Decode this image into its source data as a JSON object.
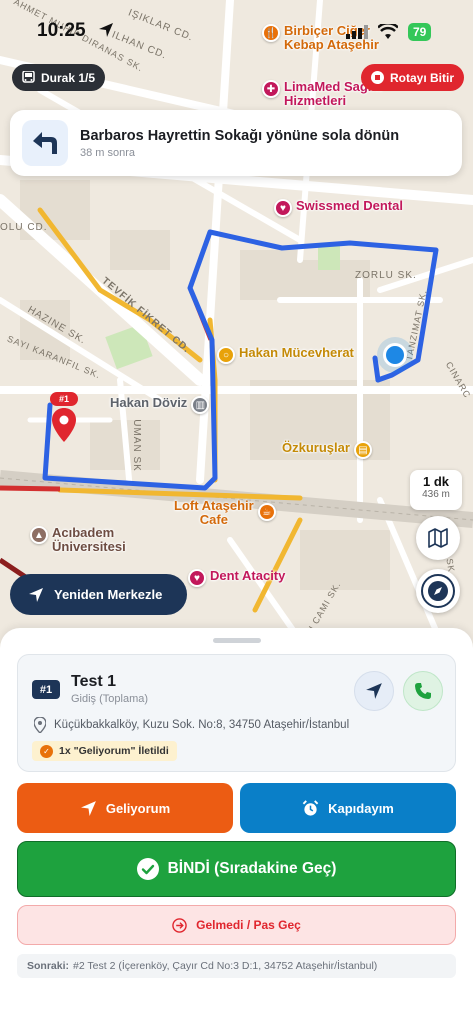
{
  "status_bar": {
    "time": "10:25",
    "battery": "79"
  },
  "map": {
    "streets": [
      "IŞIKLAR CD.",
      "AHMET MUHIP DIRANAS SK.",
      "ILHAN CD.",
      "OLU CD.",
      "TEVFİK FİKRET CD.",
      "HAZINE SK.",
      "SAYI KARANFIL SK.",
      "UMAN SK",
      "ZORLU SK.",
      "TANZIMAT SK.",
      "CINARC",
      "LU CAMI SK.",
      "ACAZ SK"
    ],
    "pois": [
      {
        "name": "Birbiçer Ciğer Kebap Ataşehir",
        "line1": "Birbiçer Ciğer",
        "line2": "Kebap Ataşehir",
        "color": "#e8710a",
        "icon": "restaurant-icon"
      },
      {
        "name": "LimaMed Sağlık Hizmetleri",
        "line1": "LimaMed Sağlık",
        "line2": "Hizmetleri",
        "color": "#c2185b",
        "icon": "health-icon"
      },
      {
        "name": "Swissmed Dental",
        "line1": "Swissmed Dental",
        "color": "#c2185b",
        "icon": "tooth-icon"
      },
      {
        "name": "Hakan Mücevherat",
        "line1": "Hakan Mücevherat",
        "color": "#e8a20a",
        "icon": "ring-icon"
      },
      {
        "name": "Hakan Döviz",
        "line1": "Hakan Döviz",
        "color": "#7a7f88",
        "icon": "bank-icon"
      },
      {
        "name": "Özkuruşlar",
        "line1": "Özkuruşlar",
        "color": "#e8a20a",
        "icon": "shop-icon"
      },
      {
        "name": "Loft Ataşehir Cafe",
        "line1": "Loft Ataşehir",
        "line2": "Cafe",
        "color": "#e8710a",
        "icon": "cafe-icon"
      },
      {
        "name": "Acıbadem Üniversitesi",
        "line1": "Acıbadem",
        "line2": "Üniversitesi",
        "color": "#8d6e63",
        "icon": "school-icon"
      },
      {
        "name": "Dent Atacity",
        "line1": "Dent Atacity",
        "color": "#c2185b",
        "icon": "tooth-icon"
      }
    ],
    "stop_marker_label": "#1"
  },
  "header": {
    "stop_chip": "Durak 1/5",
    "end_route": "Rotayı Bitir"
  },
  "navigation": {
    "instruction": "Barbaros Hayrettin Sokağı yönüne sola dönün",
    "distance": "38 m sonra",
    "eta_minutes": "1 dk",
    "eta_distance": "436 m"
  },
  "recenter_label": "Yeniden Merkezle",
  "passenger": {
    "number": "#1",
    "name": "Test 1",
    "type": "Gidiş (Toplama)",
    "address": "Küçükbakkalköy, Kuzu Sok. No:8, 34750 Ataşehir/İstanbul",
    "notice": "1x \"Geliyorum\" İletildi"
  },
  "actions": {
    "going": "Geliyorum",
    "at_door": "Kapıdayım",
    "boarded": "BİNDİ (Sıradakine Geç)",
    "no_show": "Gelmedi / Pas Geç"
  },
  "next_stop": {
    "label": "Sonraki:",
    "value": "#2 Test 2 (İçerenköy, Çayır Cd No:3 D:1, 34752 Ataşehir/İstanbul)"
  },
  "colors": {
    "route": "#2d62e3",
    "accent_dark": "#1d3557",
    "going": "#ec5c13",
    "at_door": "#0a7fc8",
    "boarded": "#1ea23e",
    "danger": "#e0262e"
  }
}
